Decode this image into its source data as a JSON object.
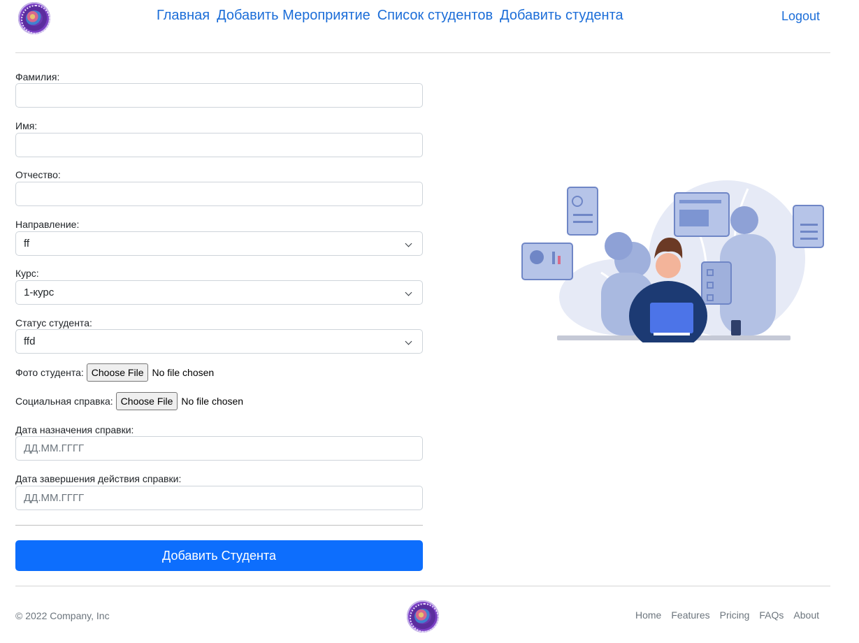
{
  "header": {
    "logo_icon": "school-emblem-logo",
    "nav": [
      {
        "label": "Главная"
      },
      {
        "label": "Добавить Мероприятие"
      },
      {
        "label": "Список студентов"
      },
      {
        "label": "Добавить студента"
      }
    ],
    "logout_label": "Logout"
  },
  "form": {
    "last_name": {
      "label": "Фамилия:",
      "value": ""
    },
    "first_name": {
      "label": "Имя:",
      "value": ""
    },
    "patronymic": {
      "label": "Отчество:",
      "value": ""
    },
    "direction": {
      "label": "Направление:",
      "value": "ff"
    },
    "course": {
      "label": "Курс:",
      "value": "1-курс"
    },
    "status": {
      "label": "Статус студента:",
      "value": "ffd"
    },
    "photo": {
      "label": "Фото студента:",
      "button": "Choose File",
      "status": "No file chosen"
    },
    "social": {
      "label": "Социальная справка:",
      "button": "Choose File",
      "status": "No file chosen"
    },
    "start_date": {
      "label": "Дата назначения справки:",
      "placeholder": "ДД.ММ.ГГГГ"
    },
    "end_date": {
      "label": "Дата завершения действия справки:",
      "placeholder": "ДД.ММ.ГГГГ"
    },
    "submit_label": "Добавить Студента"
  },
  "colors": {
    "link": "#1b6dd8",
    "primary_button": "#0d6efd",
    "border": "#ced4da",
    "muted": "#6c757d"
  },
  "footer": {
    "copyright": "© 2022 Company, Inc",
    "links": [
      {
        "label": "Home"
      },
      {
        "label": "Features"
      },
      {
        "label": "Pricing"
      },
      {
        "label": "FAQs"
      },
      {
        "label": "About"
      }
    ]
  }
}
